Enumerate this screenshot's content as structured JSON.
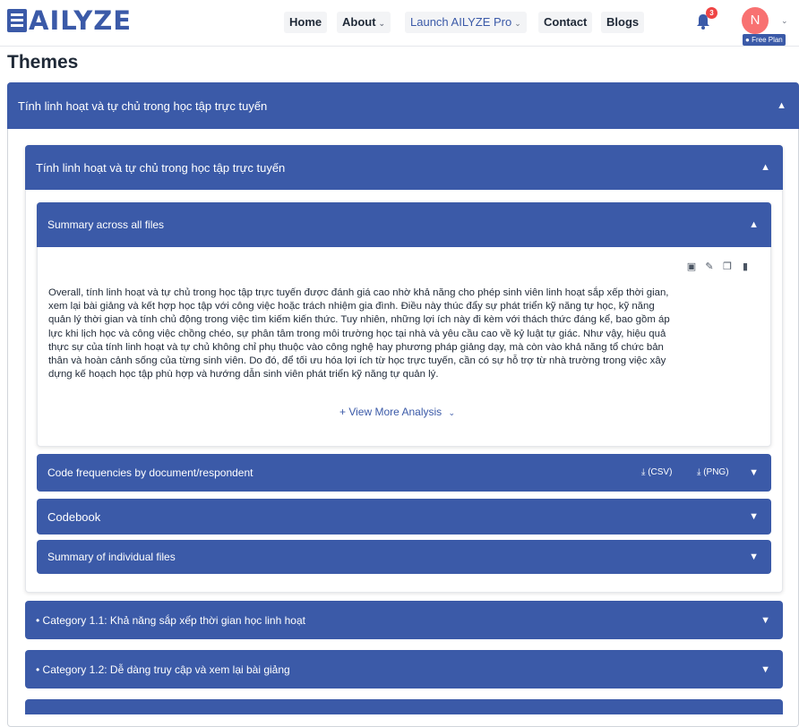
{
  "brand": {
    "name": "AILYZE"
  },
  "nav": {
    "home": "Home",
    "about": "About",
    "launch": "Launch AILYZE Pro",
    "contact": "Contact",
    "blogs": "Blogs",
    "caret": "⌄"
  },
  "notifications": {
    "count": "3"
  },
  "user": {
    "initial": "N",
    "plan": "Free Plan"
  },
  "page": {
    "title": "Themes"
  },
  "theme": {
    "outer_title": "Tính linh hoạt và tự chủ trong học tập trực tuyến",
    "inner_title": "Tính linh hoạt và tự chủ trong học tập trực tuyến",
    "summary_header": "Summary across all files",
    "summary_lines": [
      "Overall, tính linh hoạt và tự chủ trong học tập trực tuyến được đánh giá cao nhờ khả năng cho phép sinh viên linh hoạt sắp xếp thời gian,",
      "xem lại bài giảng và kết hợp học tập với công việc hoặc trách nhiệm gia đình. Điều này thúc đẩy sự phát triển kỹ năng tự học, kỹ năng",
      "quản lý thời gian và tính chủ động trong việc tìm kiếm kiến thức. Tuy nhiên, những lợi ích này đi kèm với thách thức đáng kể, bao gồm áp",
      "lực khi lịch học và công việc chồng chéo, sự phân tâm trong môi trường học tại nhà và yêu cầu cao về kỷ luật tự giác. Như vậy, hiệu quả",
      "thực sự của tính linh hoạt và tự chủ không chỉ phụ thuộc vào công nghệ hay phương pháp giảng dạy, mà còn vào khả năng tổ chức bản",
      "thân và hoàn cảnh sống của từng sinh viên. Do đó, để tối ưu hóa lợi ích từ học trực tuyến, cần có sự hỗ trợ từ nhà trường trong việc xây",
      "dựng kế hoạch học tập phù hợp và hướng dẫn sinh viên phát triển kỹ năng tự quản lý."
    ],
    "view_more": "+ View More Analysis",
    "code_freq": "Code frequencies by document/respondent",
    "csv": "(CSV)",
    "png": "(PNG)",
    "codebook": "Codebook",
    "individual": "Summary of individual files"
  },
  "categories": [
    {
      "label": "Category 1.1: Khả năng sắp xếp thời gian học linh hoạt"
    },
    {
      "label": "Category 1.2: Dễ dàng truy cập và xem lại bài giảng"
    }
  ],
  "colors": {
    "primary": "#3b5aa8",
    "badge": "#ef4444",
    "avatar": "#f87171"
  },
  "icons": [
    "bell-icon",
    "chevron-up-icon",
    "chevron-down-icon",
    "download-icon",
    "edit-icon",
    "copy-icon",
    "delete-icon",
    "save-icon",
    "user-icon"
  ]
}
